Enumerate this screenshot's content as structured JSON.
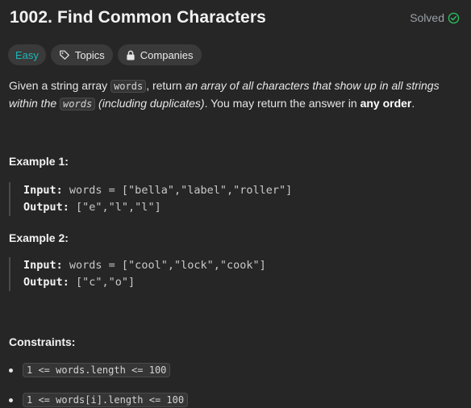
{
  "problem": {
    "title": "1002. Find Common Characters",
    "status": "Solved"
  },
  "tags": {
    "difficulty": "Easy",
    "topics": "Topics",
    "companies": "Companies"
  },
  "description": {
    "p1": "Given a string array ",
    "code1": "words",
    "p2": ", return ",
    "em1": "an array of all characters that show up in all strings within the ",
    "code2": "words",
    "em2": " (including duplicates)",
    "p3": ". You may return the answer in ",
    "strong1": "any order",
    "p4": "."
  },
  "examples": [
    {
      "heading": "Example 1:",
      "input_label": "Input:",
      "input_value": " words = [\"bella\",\"label\",\"roller\"]",
      "output_label": "Output:",
      "output_value": " [\"e\",\"l\",\"l\"]"
    },
    {
      "heading": "Example 2:",
      "input_label": "Input:",
      "input_value": " words = [\"cool\",\"lock\",\"cook\"]",
      "output_label": "Output:",
      "output_value": " [\"c\",\"o\"]"
    }
  ],
  "constraints": {
    "heading": "Constraints:",
    "items": [
      "1 <= words.length <= 100",
      "1 <= words[i].length <= 100"
    ]
  },
  "colors": {
    "background": "#262626",
    "easy": "#1cb8b8",
    "solved_icon": "#2cbb5d",
    "tag_bg": "#3a3a3a"
  },
  "icons": {
    "solved": "check-circle-icon",
    "topics": "tag-icon",
    "companies": "lock-icon"
  }
}
